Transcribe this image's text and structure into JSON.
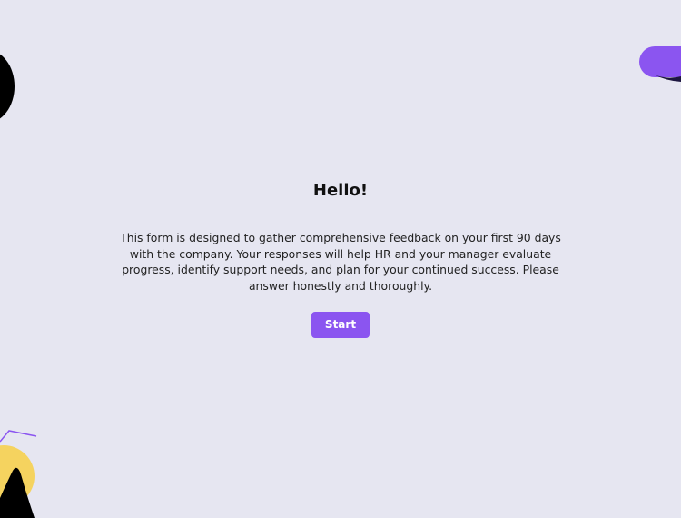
{
  "welcome": {
    "title": "Hello!",
    "description": "This form is designed to gather comprehensive feedback on your first 90 days with the company. Your responses will help HR and your manager evaluate progress, identify support needs, and plan for your continued success. Please answer honestly and thoroughly.",
    "start_label": "Start"
  },
  "colors": {
    "background": "#e6e6f1",
    "accent": "#8b55f0",
    "accent_text": "#ffffff",
    "decor_yellow": "#f5d35f",
    "decor_black": "#000000",
    "text": "#111111"
  }
}
